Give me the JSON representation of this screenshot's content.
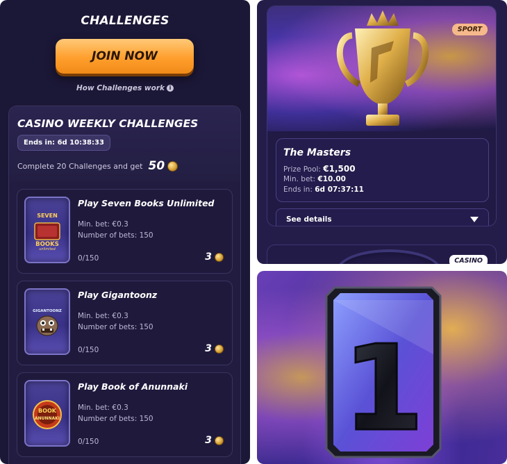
{
  "challenges": {
    "title": "CHALLENGES",
    "join_label": "JOIN NOW",
    "how_link": "How Challenges work",
    "info_icon": "i"
  },
  "weekly": {
    "title": "CASINO WEEKLY CHALLENGES",
    "ends_in": "Ends in: 6d 10:38:33",
    "reward_text": "Complete 20 Challenges and get",
    "reward_amount": "50",
    "items": [
      {
        "title": "Play Seven Books Unlimited",
        "min_bet": "Min. bet: €0.3",
        "bets": "Number of bets: 150",
        "progress": "0/150",
        "reward": "3",
        "thumb_text": [
          "SEVEN",
          "BOOKS",
          "unlimited"
        ]
      },
      {
        "title": "Play Gigantoonz",
        "min_bet": "Min. bet: €0.3",
        "bets": "Number of bets: 150",
        "progress": "0/150",
        "reward": "3",
        "thumb_text": [
          "GIGANTOONZ"
        ]
      },
      {
        "title": "Play Book of Anunnaki",
        "min_bet": "Min. bet: €0.3",
        "bets": "Number of bets: 150",
        "progress": "0/150",
        "reward": "3",
        "thumb_text": [
          "BOOK",
          "ANUNNAKI"
        ]
      }
    ]
  },
  "tournament": {
    "badge": "SPORT",
    "name": "The Masters",
    "prize_label": "Prize Pool:",
    "prize_value": "€1,500",
    "min_label": "Min. bet:",
    "min_value": "€10.00",
    "ends_label": "Ends in:",
    "ends_value": "6d 07:37:11",
    "details_label": "See details",
    "next_badge": "CASINO"
  },
  "promo": {
    "number": "1"
  },
  "icons": {
    "coin": "coin-icon",
    "info": "info-icon",
    "chevron": "chevron-down-icon",
    "trophy": "trophy-icon"
  },
  "colors": {
    "accent_orange": "#ff9f2d",
    "panel_bg": "#1b1736",
    "card_bg": "#1f1a3c",
    "sport_badge": "#f6b98b"
  }
}
